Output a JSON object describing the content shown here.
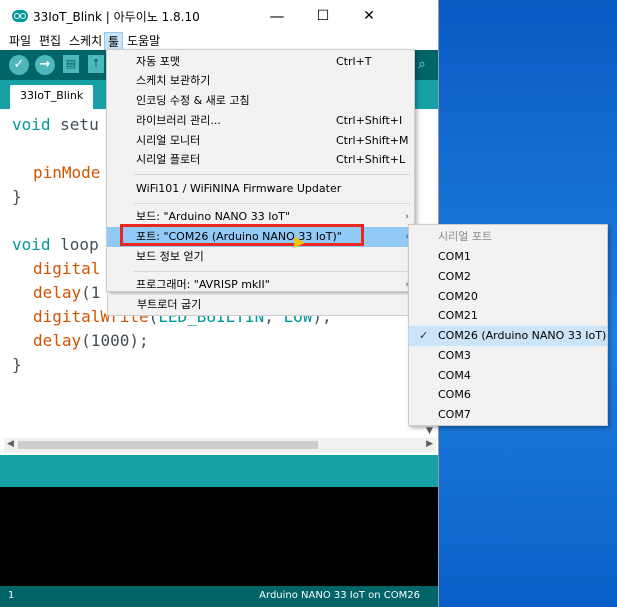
{
  "window": {
    "title": "33IoT_Blink | 아두이노 1.8.10",
    "minimize": "—",
    "maximize": "☐",
    "close": "✕"
  },
  "menubar": {
    "items": [
      "파일",
      "편집",
      "스케치",
      "툴",
      "도움말"
    ]
  },
  "toolbar": {
    "verify": "✓",
    "upload": "→",
    "new": "▤",
    "open": "↑",
    "serial": "⌕"
  },
  "tab": {
    "label": "33IoT_Blink"
  },
  "code": {
    "l1_kw": "void",
    "l1_rest": " setu",
    "l3_fn": "pinMode",
    "l4": "}",
    "l6_kw": "void",
    "l6_rest": " loop",
    "l7_fn": "digital",
    "l8_fn": "delay",
    "l8_rest": "(1",
    "l9_fn": "digitalWrite",
    "l9_p1": "(",
    "l9_c1": "LED_BUILTIN",
    "l9_p2": ", ",
    "l9_c2": "LOW",
    "l9_p3": ");",
    "l10_fn": "delay",
    "l10_rest": "(1000);",
    "l11": "}"
  },
  "tools_menu": {
    "items": [
      {
        "label": "자동 포맷",
        "shortcut": "Ctrl+T"
      },
      {
        "label": "스케치 보관하기",
        "shortcut": ""
      },
      {
        "label": "인코딩 수정 & 새로 고침",
        "shortcut": ""
      },
      {
        "label": "라이브러리 관리...",
        "shortcut": "Ctrl+Shift+I"
      },
      {
        "label": "시리얼 모니터",
        "shortcut": "Ctrl+Shift+M"
      },
      {
        "label": "시리얼 플로터",
        "shortcut": "Ctrl+Shift+L"
      },
      {
        "label": "WiFi101 / WiFiNINA Firmware Updater",
        "shortcut": ""
      },
      {
        "label": "보드: \"Arduino NANO 33 IoT\"",
        "shortcut": ""
      },
      {
        "label": "포트: \"COM26 (Arduino NANO 33 IoT)\"",
        "shortcut": ""
      },
      {
        "label": "보드 정보 얻기",
        "shortcut": ""
      },
      {
        "label": "프로그래머: \"AVRISP mkII\"",
        "shortcut": ""
      },
      {
        "label": "부트로더 굽기",
        "shortcut": ""
      }
    ],
    "arrow": "›"
  },
  "port_submenu": {
    "header": "시리얼 포트",
    "items": [
      "COM1",
      "COM2",
      "COM20",
      "COM21",
      "COM26 (Arduino NANO 33 IoT)",
      "COM3",
      "COM4",
      "COM6",
      "COM7"
    ],
    "selected": "COM26 (Arduino NANO 33 IoT)",
    "check": "✓"
  },
  "status": {
    "line": "1",
    "board": "Arduino NANO 33 IoT on COM26"
  },
  "colors": {
    "accent": "#00979c",
    "toolbar": "#006468",
    "highlight": "#e8281e",
    "menu_hover": "#91c9f7"
  }
}
